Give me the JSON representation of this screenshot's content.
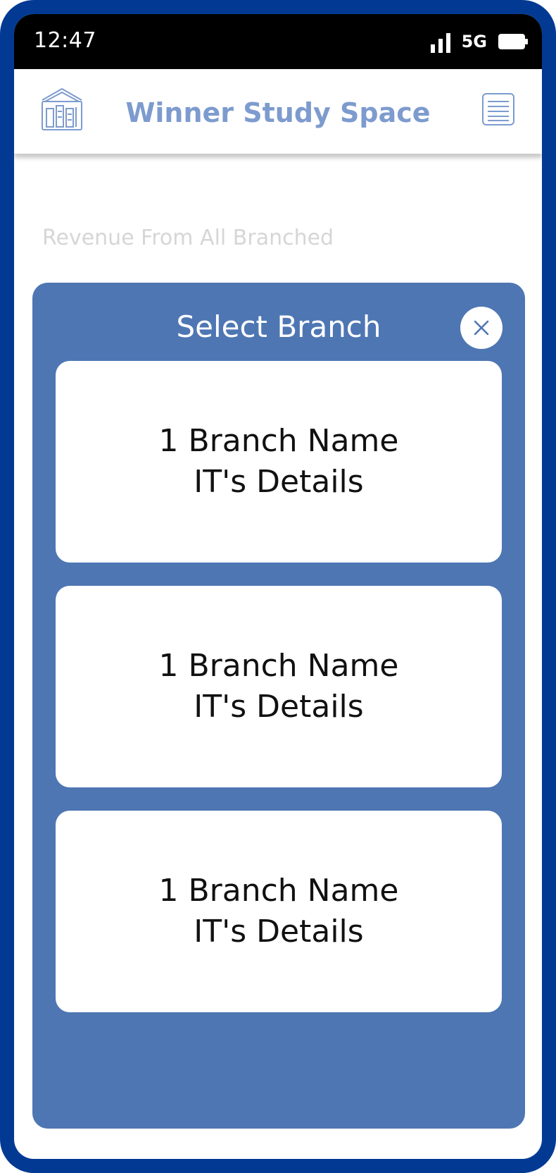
{
  "status_bar": {
    "time": "12:47",
    "network": "5G"
  },
  "app_bar": {
    "title": "Winner Study Space",
    "logo_icon": "library-building-icon",
    "menu_icon": "menu-list-icon"
  },
  "background": {
    "label": "Revenue From All Branched"
  },
  "modal": {
    "title": "Select Branch",
    "close_icon": "close-icon",
    "branches": [
      {
        "name": "1 Branch Name",
        "details": "IT's Details"
      },
      {
        "name": "1 Branch Name",
        "details": "IT's Details"
      },
      {
        "name": "1 Branch Name",
        "details": "IT's Details"
      }
    ]
  },
  "colors": {
    "frame": "#023a93",
    "modal": "#4e76b3",
    "title": "#7d9bce",
    "status_bar": "#000000"
  }
}
